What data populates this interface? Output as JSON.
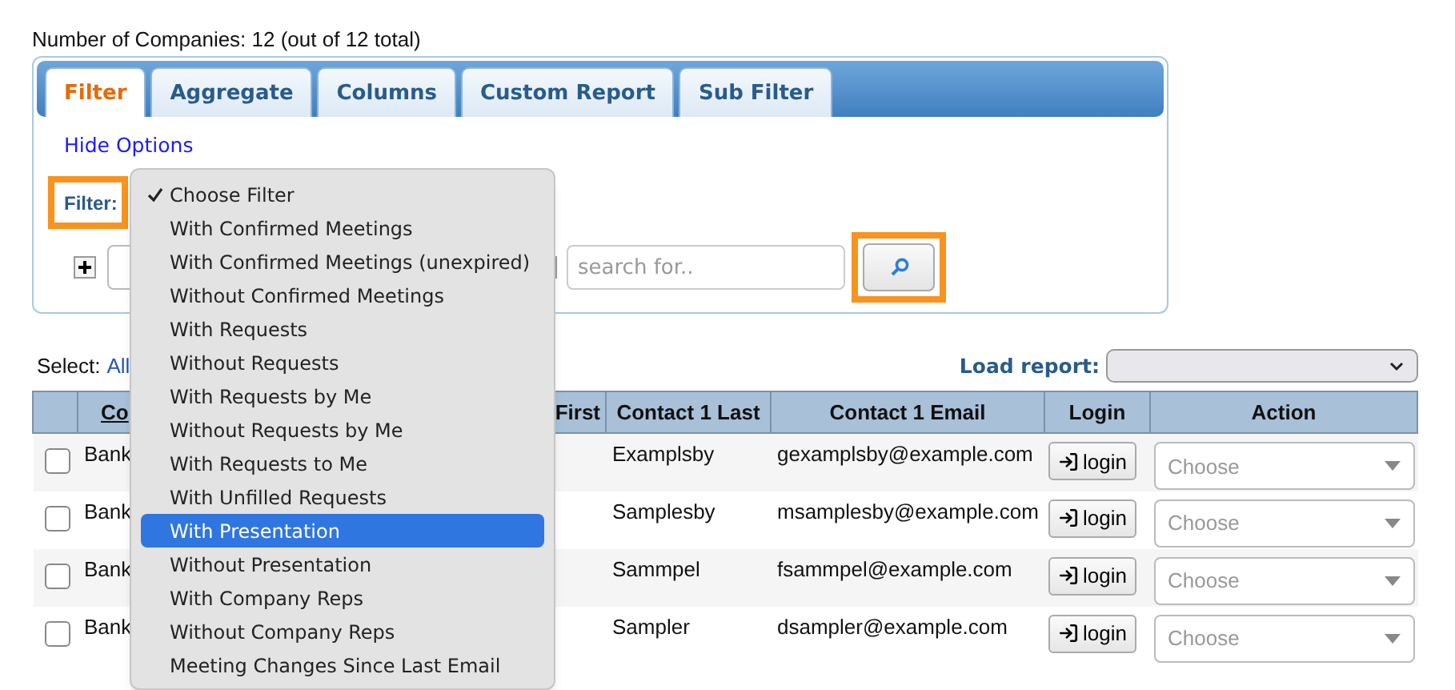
{
  "summary": "Number of Companies: 12 (out of 12 total)",
  "tabs": [
    {
      "label": "Filter",
      "selected": true
    },
    {
      "label": "Aggregate",
      "selected": false
    },
    {
      "label": "Columns",
      "selected": false
    },
    {
      "label": "Custom Report",
      "selected": false
    },
    {
      "label": "Sub Filter",
      "selected": false
    }
  ],
  "hide_options": "Hide Options",
  "filter_label": {
    "text": "Filter:",
    "highlighted": true
  },
  "filter_row": {
    "search": {
      "placeholder": "search for.."
    },
    "search_button": {
      "highlighted": true
    }
  },
  "select_label": "Select:",
  "select_all": "All",
  "load_report": {
    "label": "Load report:"
  },
  "table": {
    "columns": [
      {
        "label": "Co",
        "sortable": true
      },
      {
        "label": "First",
        "sortable": false
      },
      {
        "label": "Contact 1 Last",
        "sortable": false
      },
      {
        "label": "Contact 1 Email",
        "sortable": false
      },
      {
        "label": "Login",
        "sortable": false
      },
      {
        "label": "Action",
        "sortable": false
      }
    ],
    "rows": [
      {
        "checked": false,
        "company": "Bank",
        "last": "Examplsby",
        "email": "gexamplsby@example.com",
        "login": "login",
        "action": "Choose"
      },
      {
        "checked": false,
        "company": "Bank",
        "last": "Samplesby",
        "email": "msamplesby@example.com",
        "login": "login",
        "action": "Choose"
      },
      {
        "checked": false,
        "company": "Bank",
        "last": "Sammpel",
        "email": "fsammpel@example.com",
        "login": "login",
        "action": "Choose"
      },
      {
        "checked": false,
        "company": "Bank",
        "last": "Sampler",
        "email": "dsampler@example.com",
        "login": "login",
        "action": "Choose"
      }
    ]
  },
  "filter_menu": {
    "items": [
      {
        "label": "Choose Filter",
        "checked": true,
        "selected": false
      },
      {
        "label": "With Confirmed Meetings",
        "checked": false,
        "selected": false
      },
      {
        "label": "With Confirmed Meetings (unexpired)",
        "checked": false,
        "selected": false
      },
      {
        "label": "Without Confirmed Meetings",
        "checked": false,
        "selected": false
      },
      {
        "label": "With Requests",
        "checked": false,
        "selected": false
      },
      {
        "label": "Without Requests",
        "checked": false,
        "selected": false
      },
      {
        "label": "With Requests by Me",
        "checked": false,
        "selected": false
      },
      {
        "label": "Without Requests by Me",
        "checked": false,
        "selected": false
      },
      {
        "label": "With Requests to Me",
        "checked": false,
        "selected": false
      },
      {
        "label": "With Unfilled Requests",
        "checked": false,
        "selected": false
      },
      {
        "label": "With Presentation",
        "checked": false,
        "selected": true
      },
      {
        "label": "Without Presentation",
        "checked": false,
        "selected": false
      },
      {
        "label": "With Company Reps",
        "checked": false,
        "selected": false
      },
      {
        "label": "Without Company Reps",
        "checked": false,
        "selected": false
      },
      {
        "label": "Meeting Changes Since Last Email",
        "checked": false,
        "selected": false
      }
    ]
  }
}
